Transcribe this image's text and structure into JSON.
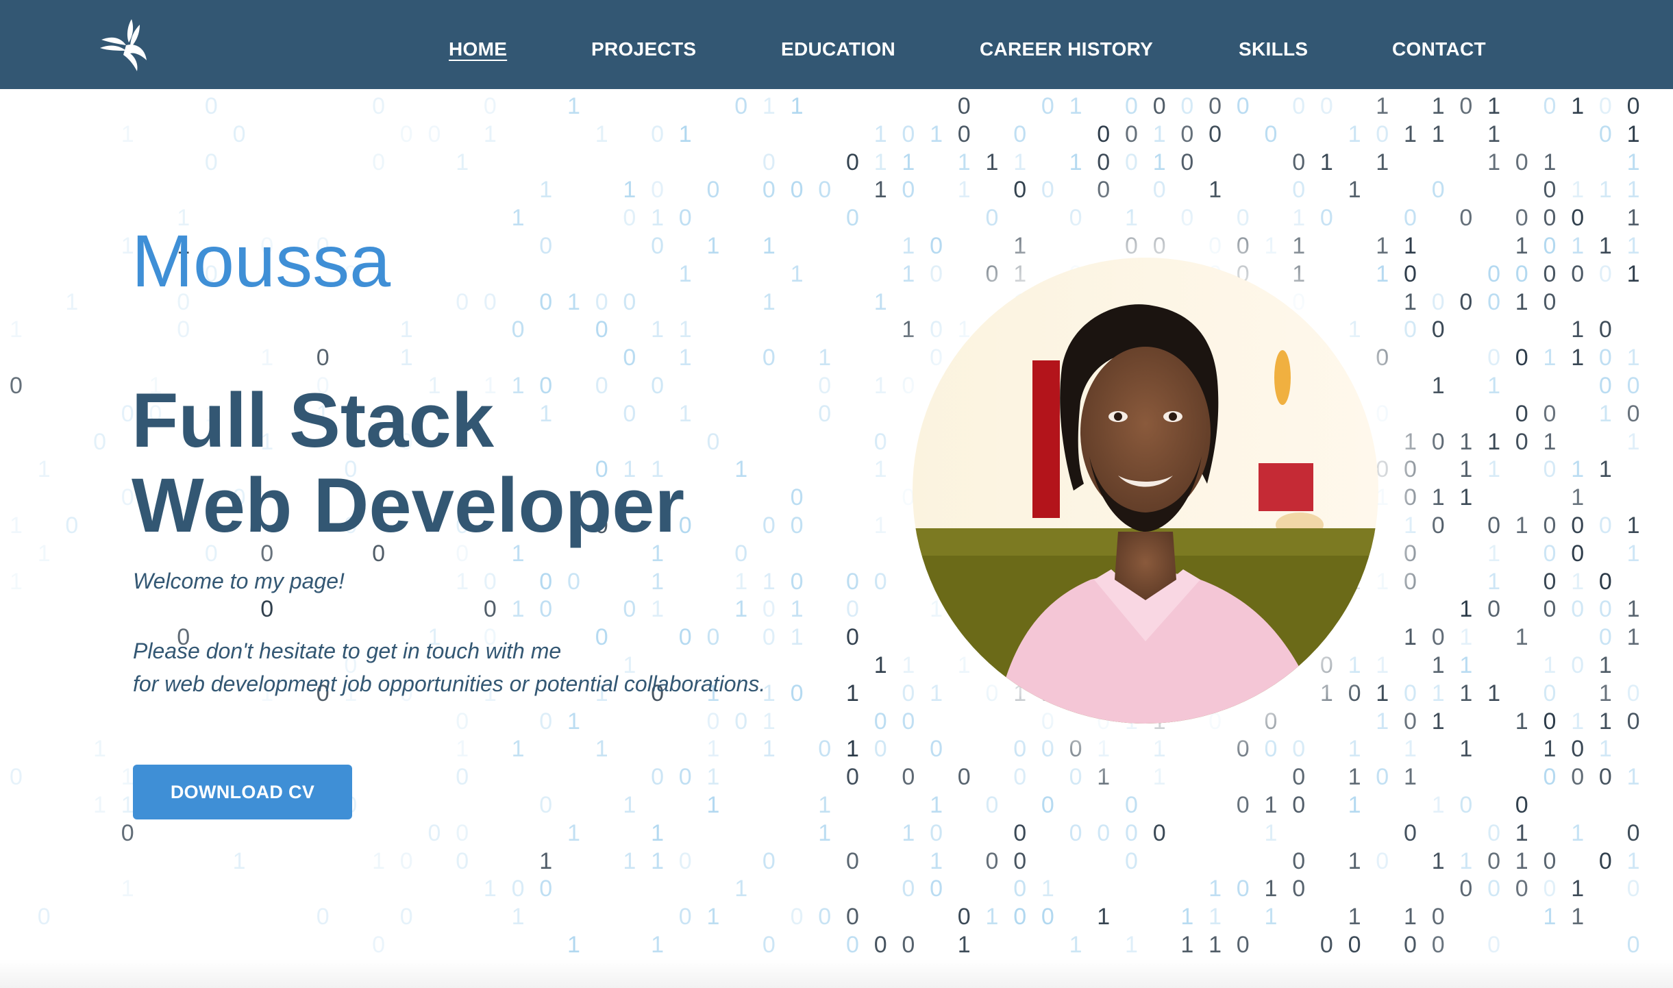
{
  "brand": {
    "logo_icon": "bird-wing-icon"
  },
  "nav": {
    "items": [
      {
        "label": "HOME",
        "active": true
      },
      {
        "label": "PROJECTS",
        "active": false
      },
      {
        "label": "EDUCATION",
        "active": false
      },
      {
        "label": "CAREER HISTORY",
        "active": false
      },
      {
        "label": "SKILLS",
        "active": false
      },
      {
        "label": "CONTACT",
        "active": false
      }
    ]
  },
  "hero": {
    "name": "Moussa",
    "headline_line1": "Full Stack",
    "headline_line2": "Web Developer",
    "welcome": "Welcome to my page!",
    "invite_line1": "Please don't hesitate to get in touch with me",
    "invite_line2": "for web development job opportunities or potential collaborations.",
    "cv_button": "DOWNLOAD CV",
    "portrait_icon": "profile-photo"
  },
  "background": {
    "pattern": "binary-rain",
    "digits": [
      "0",
      "1"
    ]
  },
  "colors": {
    "nav_bg": "#335773",
    "accent": "#3f8fd6",
    "heading": "#335773",
    "binary_dark": "#2b3a48",
    "binary_light": "#a9d4ef"
  }
}
